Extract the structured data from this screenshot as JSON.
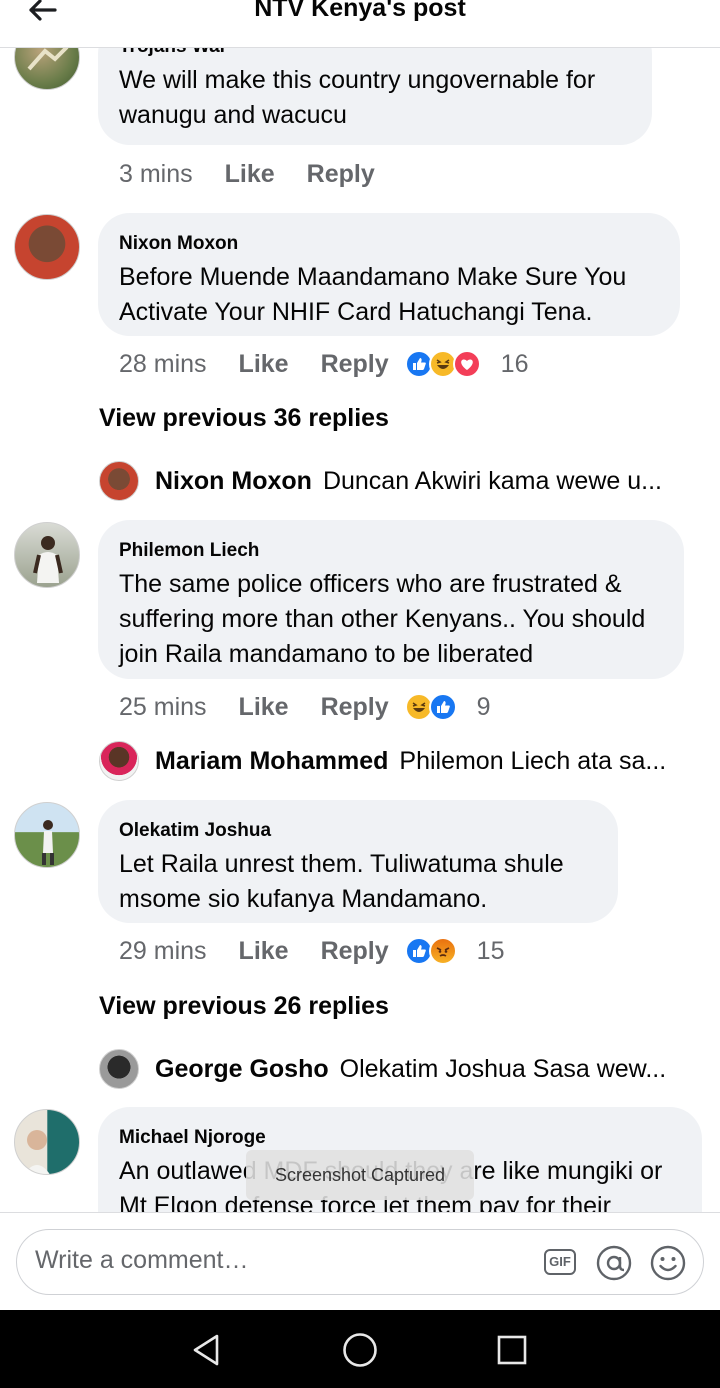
{
  "header": {
    "title": "NTV Kenya's post",
    "back_icon": "arrow-left-icon"
  },
  "comments": [
    {
      "author": "Trojans War",
      "text": "We will make this country ungovernable for wanugu and wacucu",
      "time": "3 mins",
      "like": "Like",
      "reply": "Reply"
    },
    {
      "author": "Nixon Moxon",
      "text": "Before Muende Maandamano Make Sure You Activate Your NHIF Card Hatuchangi Tena.",
      "time": "28 mins",
      "like": "Like",
      "reply": "Reply",
      "reactions": [
        "like",
        "haha",
        "love"
      ],
      "reaction_count": "16",
      "view_previous": "View previous 36 replies",
      "latest_reply": {
        "author": "Nixon Moxon",
        "text": "Duncan Akwiri kama wewe u..."
      }
    },
    {
      "author": "Philemon Liech",
      "text": "The same police officers who are frustrated & suffering more than other Kenyans.. You should join Raila mandamano to be liberated",
      "time": "25 mins",
      "like": "Like",
      "reply": "Reply",
      "reactions": [
        "haha",
        "like"
      ],
      "reaction_count": "9",
      "latest_reply": {
        "author": "Mariam Mohammed",
        "text": "Philemon Liech ata sa..."
      }
    },
    {
      "author": "Olekatim Joshua",
      "text": "Let Raila unrest them. Tuliwatuma shule msome sio kufanya Mandamano.",
      "time": "29 mins",
      "like": "Like",
      "reply": "Reply",
      "reactions": [
        "like",
        "angry"
      ],
      "reaction_count": "15",
      "view_previous": "View previous 26 replies",
      "latest_reply": {
        "author": "George Gosho",
        "text": "Olekatim Joshua Sasa wew..."
      }
    },
    {
      "author": "Michael Njoroge",
      "text": "An outlawed MDF should they are like mungiki or Mt Elgon defense force let them pay for their"
    }
  ],
  "toast": "Screenshot Captured",
  "composer": {
    "placeholder": "Write a comment…",
    "gif_label": "GIF"
  },
  "colors": {
    "bubble": "#f0f2f5",
    "meta_text": "#65676b",
    "like_blue": "#1877f2",
    "love_red": "#f33e58",
    "haha_yellow": "#f7b928"
  }
}
